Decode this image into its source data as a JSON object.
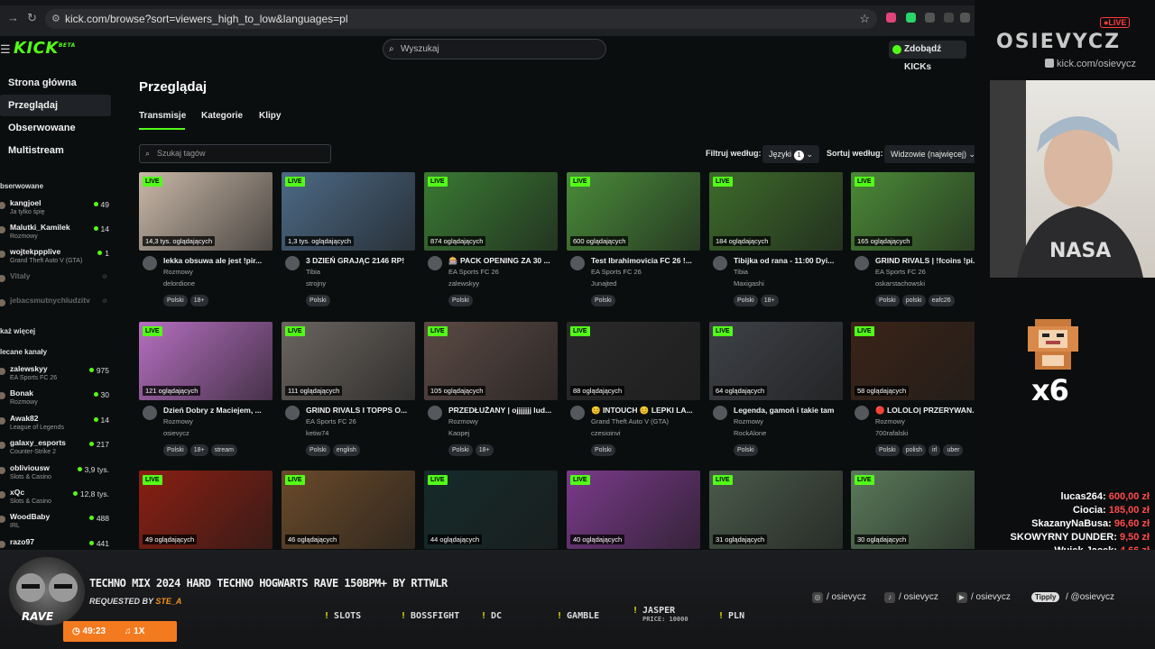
{
  "browser": {
    "url": "kick.com/browse?sort=viewers_high_to_low&languages=pl"
  },
  "header": {
    "logo": "KICK",
    "logo_sup": "BETA",
    "search_placeholder": "Wyszukaj",
    "get_kicks": "Zdobądź KICKs"
  },
  "sidebar": {
    "nav": [
      "Strona główna",
      "Przeglądaj",
      "Obserwowane",
      "Multistream"
    ],
    "followed_header": "bserwowane",
    "followed": [
      {
        "name": "kangjoel",
        "sub": "Ja tylko śpię",
        "viewers": "49"
      },
      {
        "name": "Malutki_Kamilek",
        "sub": "Rozmowy",
        "viewers": "14"
      },
      {
        "name": "wojtekppplive",
        "sub": "Grand Theft Auto V (GTA)",
        "viewers": "1"
      },
      {
        "name": "Vitaly",
        "sub": "",
        "viewers": ""
      },
      {
        "name": "jebacsmutnychludzitv",
        "sub": "",
        "viewers": ""
      }
    ],
    "show_more": "każ więcej",
    "recommended_header": "lecane kanały",
    "recommended": [
      {
        "name": "zalewskyy",
        "sub": "EA Sports FC 26",
        "viewers": "975"
      },
      {
        "name": "Bonak",
        "sub": "Rozmowy",
        "viewers": "30"
      },
      {
        "name": "Awak82",
        "sub": "League of Legends",
        "viewers": "14"
      },
      {
        "name": "galaxy_esports",
        "sub": "Counter-Strike 2",
        "viewers": "217"
      },
      {
        "name": "obliviousw",
        "sub": "Slots & Casino",
        "viewers": "3,9 tys."
      },
      {
        "name": "xQc",
        "sub": "Slots & Casino",
        "viewers": "12,8 tys."
      },
      {
        "name": "WoodBaby",
        "sub": "IRL",
        "viewers": "488"
      },
      {
        "name": "razo97",
        "sub": "",
        "viewers": "441"
      }
    ]
  },
  "main": {
    "title": "Przeglądaj",
    "tabs": [
      "Transmisje",
      "Kategorie",
      "Klipy"
    ],
    "tag_search_placeholder": "Szukaj tagów",
    "filter_label": "Filtruj według:",
    "languages_btn": "Języki",
    "languages_count": "1",
    "sort_label": "Sortuj według:",
    "sort_value": "Widzowie (najwięcej)"
  },
  "streams": [
    {
      "viewers": "14,3 tys. oglądających",
      "title": "lekka obsuwa ale jest !pir...",
      "game": "Rozmowy",
      "user": "delordione",
      "tags": [
        "Polski",
        "18+"
      ],
      "color": "#c9b8a8"
    },
    {
      "viewers": "1,3 tys. oglądających",
      "title": "3 DZIEŃ GRAJĄC 2146 RP!",
      "game": "Tibia",
      "user": "strojny",
      "tags": [
        "Polski"
      ],
      "color": "#4d6a86"
    },
    {
      "viewers": "874 oglądających",
      "title": "🎰 PACK OPENING ZA 30 ...",
      "game": "EA Sports FC 26",
      "user": "zalewskyy",
      "tags": [
        "Polski"
      ],
      "color": "#3a7a33"
    },
    {
      "viewers": "600 oglądających",
      "title": "Test Ibrahimovicia FC 26 !...",
      "game": "EA Sports FC 26",
      "user": "Junajted",
      "tags": [
        "Polski"
      ],
      "color": "#4a8c3a"
    },
    {
      "viewers": "184 oglądających",
      "title": "Tibijka od rana - 11:00 Dyi...",
      "game": "Tibia",
      "user": "Maxigashi",
      "tags": [
        "Polski",
        "18+"
      ],
      "color": "#3d6b2a"
    },
    {
      "viewers": "165 oglądających",
      "title": "GRIND RIVALS | !fcoins !pi...",
      "game": "EA Sports FC 26",
      "user": "oskarstachowski",
      "tags": [
        "Polski",
        "polski",
        "eafc26"
      ],
      "color": "#4b8a37"
    },
    {
      "viewers": "121 oglądających",
      "title": "Dzień Dobry z Maciejem, ...",
      "game": "Rozmowy",
      "user": "osievycz",
      "tags": [
        "Polski",
        "18+",
        "stream"
      ],
      "color": "#b56fc0"
    },
    {
      "viewers": "111 oglądających",
      "title": "GRIND RIVALS I TOPPS O...",
      "game": "EA Sports FC 26",
      "user": "ketiw74",
      "tags": [
        "Polski",
        "english"
      ],
      "color": "#6b6560"
    },
    {
      "viewers": "105 oglądających",
      "title": "PRZEDŁUŻANY | ojjjjjjj lud...",
      "game": "Rozmowy",
      "user": "Kaopej",
      "tags": [
        "Polski",
        "18+"
      ],
      "color": "#5b4a44"
    },
    {
      "viewers": "88 oglądających",
      "title": "😊 INTOUCH 😊 LEPKI LA...",
      "game": "Grand Theft Auto V (GTA)",
      "user": "czesioinvi",
      "tags": [
        "Polski"
      ],
      "color": "#2a2a2a"
    },
    {
      "viewers": "64 oglądających",
      "title": "Legenda, gamoń i takie tam",
      "game": "Rozmowy",
      "user": "RockAlone",
      "tags": [
        "Polski"
      ],
      "color": "#3e4147"
    },
    {
      "viewers": "58 oglądających",
      "title": "🔴 LOLOLO| PRZERYWAN...",
      "game": "Rozmowy",
      "user": "700rafalski",
      "tags": [
        "Polski",
        "polish",
        "irl",
        "uber"
      ],
      "color": "#3a2418"
    },
    {
      "viewers": "49 oglądających",
      "title": "",
      "game": "",
      "user": "",
      "tags": [],
      "color": "#8a1f12"
    },
    {
      "viewers": "46 oglądających",
      "title": "",
      "game": "",
      "user": "",
      "tags": [],
      "color": "#6a4a2a"
    },
    {
      "viewers": "44 oglądających",
      "title": "",
      "game": "",
      "user": "",
      "tags": [],
      "color": "#162a2a"
    },
    {
      "viewers": "40 oglądających",
      "title": "",
      "game": "",
      "user": "",
      "tags": [],
      "color": "#7a3a8a"
    },
    {
      "viewers": "31 oglądających",
      "title": "",
      "game": "",
      "user": "",
      "tags": [],
      "color": "#4a5a4a"
    },
    {
      "viewers": "30 oglądających",
      "title": "",
      "game": "",
      "user": "",
      "tags": [],
      "color": "#5a7a5a"
    }
  ],
  "live_label": "LIVE",
  "overlay": {
    "live_badge": "●LIVE",
    "brand": "OSIEVYCZ",
    "kick_handle": "kick.com/osievycz",
    "combo": "x6",
    "donations": [
      {
        "name": "lucas264:",
        "amount": "600,00 zł"
      },
      {
        "name": "Ciocia:",
        "amount": "185,00 zł"
      },
      {
        "name": "SkazanyNaBusa:",
        "amount": "96,60 zł"
      },
      {
        "name": "SKOWYRNY DUNDER:",
        "amount": "9,50 zł"
      },
      {
        "name": "Wujek Jacek:",
        "amount": "4,66 zł"
      }
    ]
  },
  "music": {
    "title": "TECHNO MIX 2024 HARD TECHNO HOGWARTS RAVE 150BPM+ BY RTTWLR",
    "requested_label": "REQUESTED BY",
    "requested_by": "STE_A",
    "rave": "RAVE",
    "time": "49:23",
    "count": "1X"
  },
  "commands": [
    "SLOTS",
    "BOSSFIGHT",
    "DC",
    "GAMBLE",
    "JASPER",
    "PRICE: 10000",
    "PLN"
  ],
  "socials": [
    "/ osievycz",
    "/ osievycz",
    "/ osievycz",
    "/ @osievycz"
  ],
  "tipply": "Tipply"
}
